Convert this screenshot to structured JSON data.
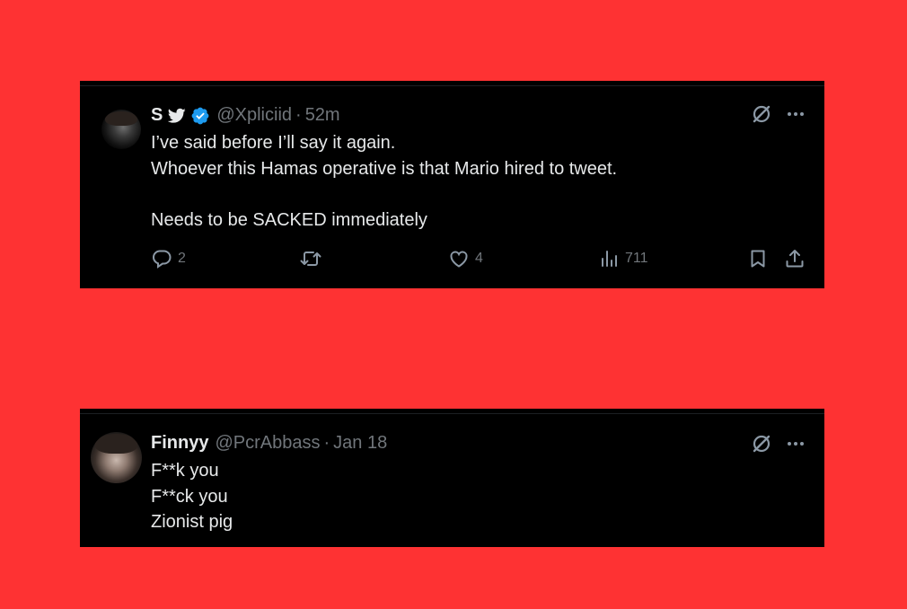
{
  "colors": {
    "background": "#fe3233",
    "card": "#000000",
    "text": "#e7e9ea",
    "muted": "#71767b",
    "verified": "#1d9bf0"
  },
  "tweets": [
    {
      "name": "S",
      "handle": "@Xpliciid",
      "separator": "·",
      "time": "52m",
      "verified": true,
      "text": "I’ve said before I’ll say it again.\nWhoever this Hamas operative is that  Mario hired to tweet.\n\nNeeds to be SACKED immediately",
      "actions": {
        "replies": "2",
        "likes": "4",
        "views": "711"
      },
      "icons": [
        "grok-icon",
        "more-icon",
        "reply-icon",
        "retweet-icon",
        "like-icon",
        "views-icon",
        "bookmark-icon",
        "share-icon"
      ]
    },
    {
      "name": "Finnyy",
      "handle": "@PcrAbbass",
      "separator": "·",
      "time": "Jan 18",
      "verified": false,
      "text": "F**k you\nF**ck you\nZionist pig",
      "icons": [
        "grok-icon",
        "more-icon"
      ]
    }
  ]
}
